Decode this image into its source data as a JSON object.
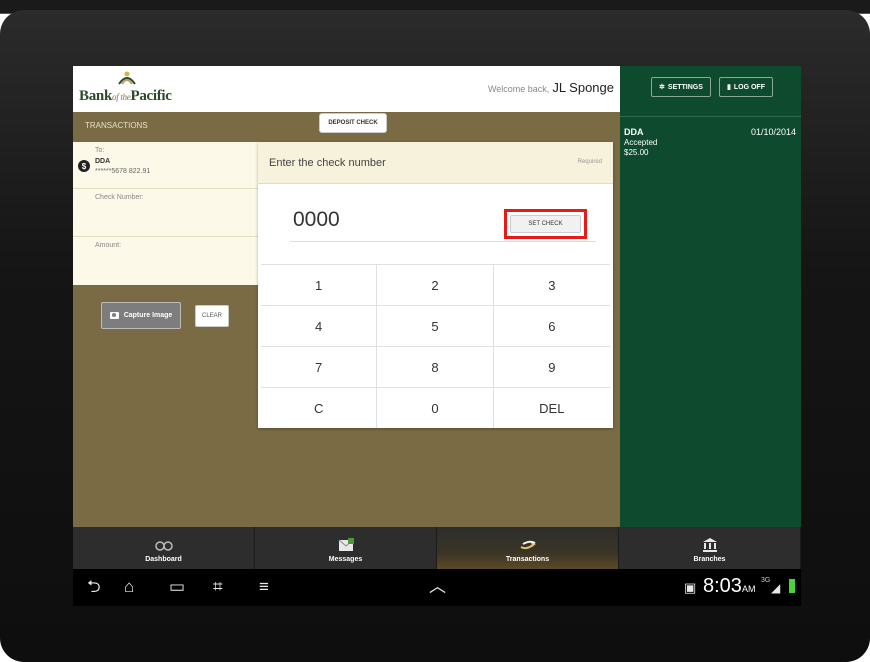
{
  "header": {
    "bank_name": "Bank",
    "bank_name_small": "of the",
    "bank_name_end": "Pacific",
    "welcome_prefix": "Welcome back,",
    "user_name": "JL Sponge"
  },
  "toolbar": {
    "settings_label": "SETTINGS",
    "logoff_label": "LOG OFF"
  },
  "transactions": {
    "section_label": "TRANSACTIONS",
    "deposit_label": "DEPOSIT CHECK"
  },
  "form": {
    "to_label": "To:",
    "to_account": "DDA",
    "to_number": "******5678 822.91",
    "check_number_label": "Check Number:",
    "amount_label": "Amount:",
    "capture_label": "Capture Image",
    "clear_label": "CLEAR"
  },
  "panel": {
    "title": "Enter the check number",
    "required": "Required",
    "check_value": "0000",
    "set_check_label": "SET CHECK",
    "keys": [
      "1",
      "2",
      "3",
      "4",
      "5",
      "6",
      "7",
      "8",
      "9",
      "C",
      "0",
      "DEL"
    ]
  },
  "recent": {
    "account": "DDA",
    "date": "01/10/2014",
    "status": "Accepted",
    "amount": "$25.00"
  },
  "nav": {
    "items": [
      {
        "label": "Dashboard",
        "icon": "glasses-icon"
      },
      {
        "label": "Messages",
        "icon": "envelope-icon"
      },
      {
        "label": "Transactions",
        "icon": "transfer-arrows-icon"
      },
      {
        "label": "Branches",
        "icon": "bank-building-icon"
      }
    ],
    "active": "Transactions"
  },
  "system": {
    "time": "8:03",
    "ampm": "AM",
    "network": "3G"
  },
  "colors": {
    "brand_green": "#0d4a2e",
    "brand_tan": "#7a6b45",
    "highlight_red": "#e41b17"
  }
}
